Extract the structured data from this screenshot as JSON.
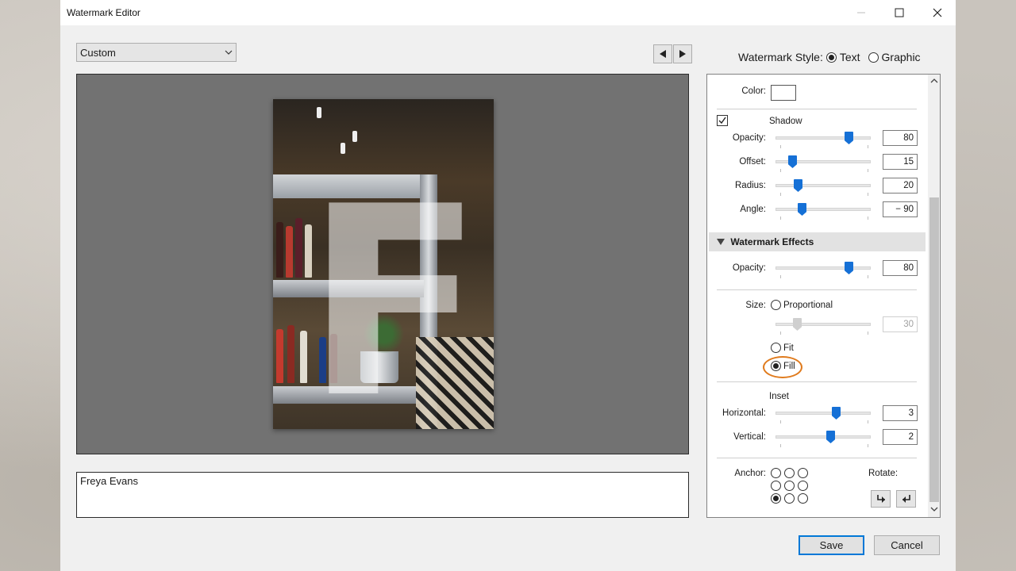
{
  "window": {
    "title": "Watermark Editor"
  },
  "preset": {
    "value": "Custom"
  },
  "preview": {
    "watermark_text_field": "Freya Evans"
  },
  "style": {
    "label": "Watermark Style:",
    "options": [
      "Text",
      "Graphic"
    ],
    "selected": "Text"
  },
  "panel": {
    "color_label": "Color:",
    "shadow": {
      "label": "Shadow",
      "checked": true,
      "opacity_label": "Opacity:",
      "opacity_value": "80",
      "offset_label": "Offset:",
      "offset_value": "15",
      "radius_label": "Radius:",
      "radius_value": "20",
      "angle_label": "Angle:",
      "angle_value": "− 90"
    },
    "effects": {
      "header": "Watermark Effects",
      "opacity_label": "Opacity:",
      "opacity_value": "80",
      "size_label": "Size:",
      "proportional_label": "Proportional",
      "proportional_value": "30",
      "fit_label": "Fit",
      "fill_label": "Fill",
      "size_selected": "Fill",
      "inset_label": "Inset",
      "horizontal_label": "Horizontal:",
      "horizontal_value": "3",
      "vertical_label": "Vertical:",
      "vertical_value": "2",
      "anchor_label": "Anchor:",
      "anchor_selected": "bottom-left",
      "rotate_label": "Rotate:"
    }
  },
  "buttons": {
    "save": "Save",
    "cancel": "Cancel"
  },
  "colors": {
    "accent": "#1570d6",
    "highlight_ring": "#e07b1d",
    "default_button_border": "#0078d7"
  }
}
